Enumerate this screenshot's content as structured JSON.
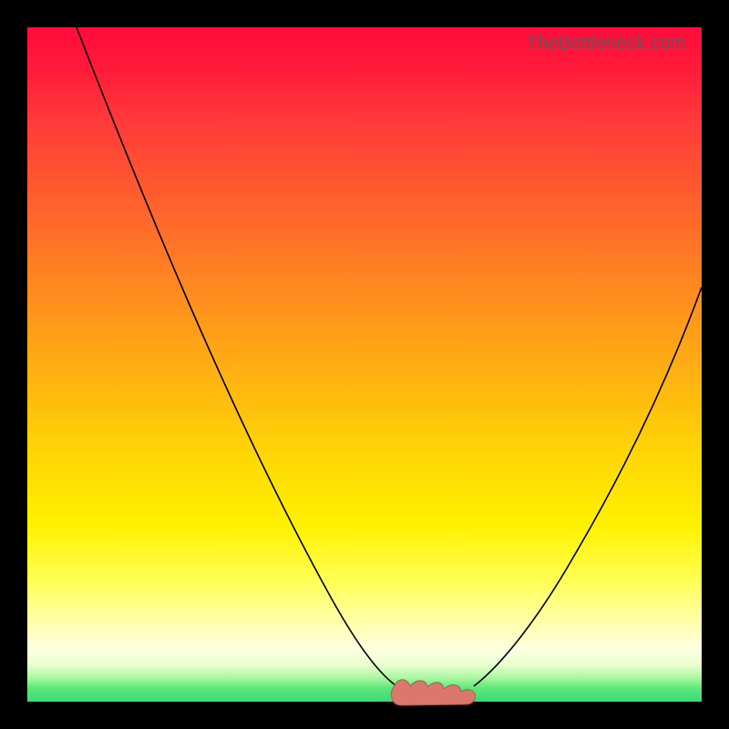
{
  "watermark": "TheBottleneck.com",
  "colors": {
    "frame": "#000000",
    "gradient_top": "#ff0b3b",
    "gradient_bottom": "#3ada77",
    "curve": "#000000",
    "marker_fill": "#d9786b",
    "marker_stroke": "#ad5c52"
  },
  "chart_data": {
    "type": "line",
    "title": "",
    "xlabel": "",
    "ylabel": "",
    "xlim": [
      0,
      100
    ],
    "ylim": [
      0,
      100
    ],
    "grid": false,
    "legend": false,
    "series": [
      {
        "name": "bottleneck-curve",
        "x": [
          5,
          10,
          15,
          20,
          25,
          30,
          35,
          40,
          45,
          50,
          52,
          54,
          56,
          58,
          60,
          62,
          64,
          66,
          70,
          75,
          80,
          85,
          90,
          95,
          100
        ],
        "y": [
          100,
          91,
          82,
          73,
          64,
          55,
          46,
          37,
          28,
          18,
          13,
          8,
          4,
          2,
          1,
          1,
          2,
          4,
          10,
          18,
          27,
          36,
          45,
          54,
          62
        ]
      }
    ],
    "annotations": [
      {
        "name": "trough-marker",
        "shape": "rounded-blob",
        "color": "#d9786b",
        "x_range": [
          54,
          66
        ],
        "y": 2
      }
    ]
  }
}
